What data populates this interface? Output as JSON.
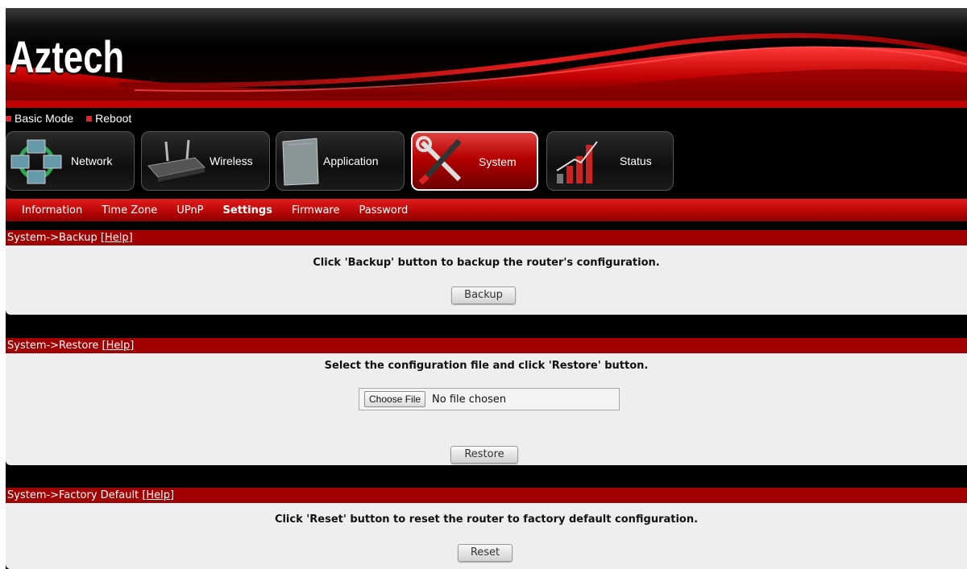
{
  "header": {
    "brand": "Aztech"
  },
  "quick_links": [
    {
      "label": "Basic Mode"
    },
    {
      "label": "Reboot"
    }
  ],
  "nav": {
    "tabs": [
      {
        "label": "Network",
        "icon": "network-icon"
      },
      {
        "label": "Wireless",
        "icon": "router-icon"
      },
      {
        "label": "Application",
        "icon": "application-icon"
      },
      {
        "label": "System",
        "icon": "tools-icon",
        "active": true
      },
      {
        "label": "Status",
        "icon": "status-chart-icon"
      }
    ]
  },
  "submenu": {
    "items": [
      {
        "label": "Information"
      },
      {
        "label": "Time Zone"
      },
      {
        "label": "UPnP"
      },
      {
        "label": "Settings",
        "active": true
      },
      {
        "label": "Firmware"
      },
      {
        "label": "Password"
      }
    ]
  },
  "sections": {
    "backup": {
      "title": "System->Backup",
      "help": "[Help]",
      "message": "Click 'Backup' button to backup the router's configuration.",
      "button": "Backup"
    },
    "restore": {
      "title": "System->Restore",
      "help": "[Help]",
      "message": "Select the configuration file and click 'Restore' button.",
      "choose_file": "Choose File",
      "file_status": "No file chosen",
      "button": "Restore"
    },
    "factory": {
      "title": "System->Factory Default",
      "help": "[Help]",
      "message": "Click 'Reset' button to reset the router to factory default configuration.",
      "button": "Reset"
    }
  },
  "colors": {
    "accent_red": "#b60606",
    "section_header": "#a00000",
    "panel_bg": "#efeeee",
    "background": "#000000"
  }
}
